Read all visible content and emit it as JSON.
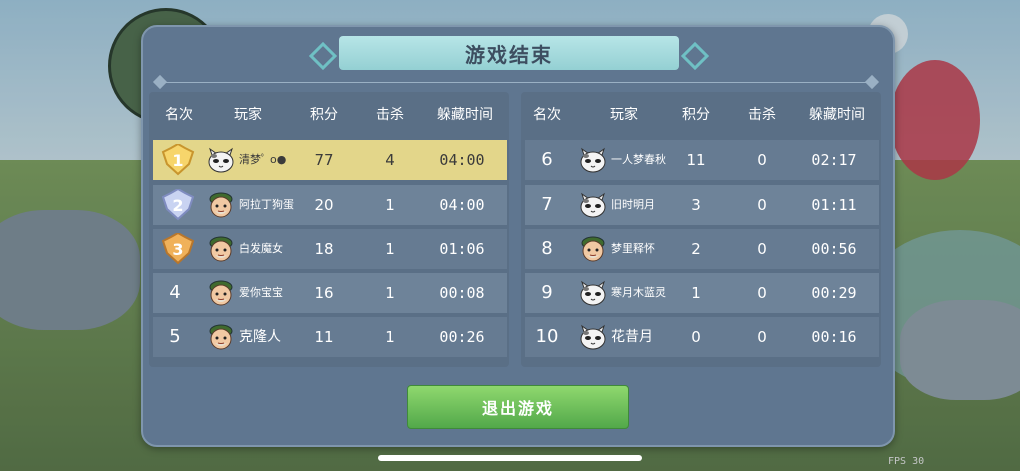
{
  "window": {
    "title": "游戏结束"
  },
  "hud": {
    "fps_label": "FPS 30"
  },
  "columns": {
    "rank": "名次",
    "player": "玩家",
    "score": "积分",
    "kills": "击杀",
    "hide_time": "躲藏时间"
  },
  "left_table": [
    {
      "rank": "1",
      "name": "清梦ﾟ o●",
      "score": "77",
      "kills": "4",
      "time": "04:00",
      "avatar": "cat-avatar-icon",
      "medal": "gold-medal-icon"
    },
    {
      "rank": "2",
      "name": "阿拉丁狗蛋",
      "score": "20",
      "kills": "1",
      "time": "04:00",
      "avatar": "old-man-avatar-icon",
      "medal": "silver-medal-icon"
    },
    {
      "rank": "3",
      "name": "白发魔女",
      "score": "18",
      "kills": "1",
      "time": "01:06",
      "avatar": "old-man-avatar-icon",
      "medal": "bronze-medal-icon"
    },
    {
      "rank": "4",
      "name": "爱你宝宝",
      "score": "16",
      "kills": "1",
      "time": "00:08",
      "avatar": "old-man-avatar-icon"
    },
    {
      "rank": "5",
      "name": "克隆人",
      "score": "11",
      "kills": "1",
      "time": "00:26",
      "avatar": "old-man-avatar-icon"
    }
  ],
  "right_table": [
    {
      "rank": "6",
      "name": "一人梦春秋",
      "score": "11",
      "kills": "0",
      "time": "02:17",
      "avatar": "cat-avatar-icon"
    },
    {
      "rank": "7",
      "name": "旧时明月",
      "score": "3",
      "kills": "0",
      "time": "01:11",
      "avatar": "cat-avatar-icon"
    },
    {
      "rank": "8",
      "name": "梦里释怀",
      "score": "2",
      "kills": "0",
      "time": "00:56",
      "avatar": "old-man-avatar-icon"
    },
    {
      "rank": "9",
      "name": "寒月木蓝灵",
      "score": "1",
      "kills": "0",
      "time": "00:29",
      "avatar": "cat-avatar-icon"
    },
    {
      "rank": "10",
      "name": "花昔月",
      "score": "0",
      "kills": "0",
      "time": "00:16",
      "avatar": "cat-avatar-icon"
    }
  ],
  "exit_button": {
    "label": "退出游戏"
  },
  "colors": {
    "panel": "#5f7690",
    "highlight": "#e3d68a",
    "exit_button": "#5fb050",
    "title_bar": "#a8dcdf"
  }
}
